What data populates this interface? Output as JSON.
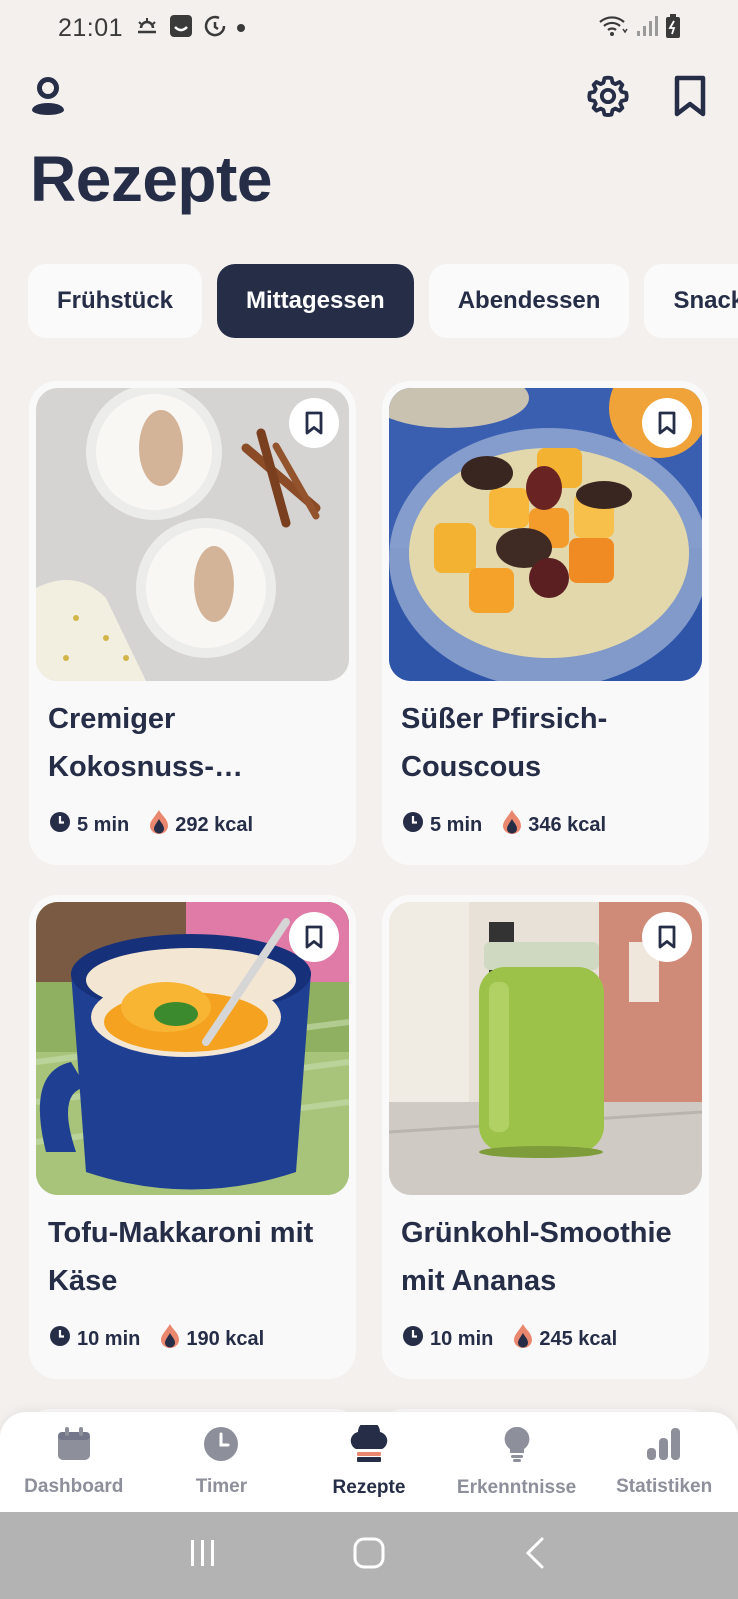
{
  "status_bar": {
    "time": "21:01"
  },
  "header": {
    "title": "Rezepte"
  },
  "tabs": [
    {
      "label": "Frühstück",
      "active": false
    },
    {
      "label": "Mittagessen",
      "active": true
    },
    {
      "label": "Abendessen",
      "active": false
    },
    {
      "label": "Snacks",
      "active": false
    }
  ],
  "recipes": [
    {
      "title": "Cremiger Kokosnuss-Reispu…",
      "time": "5 min",
      "kcal": "292 kcal",
      "image": "rice-pudding"
    },
    {
      "title": "Süßer Pfirsich-Couscous",
      "time": "5 min",
      "kcal": "346 kcal",
      "image": "peach-couscous"
    },
    {
      "title": "Tofu-Makkaroni mit Käse",
      "time": "10 min",
      "kcal": "190 kcal",
      "image": "mac-mug"
    },
    {
      "title": "Grünkohl-Smoothie mit Ananas",
      "time": "10 min",
      "kcal": "245 kcal",
      "image": "green-smoothie"
    }
  ],
  "bottom_nav": [
    {
      "label": "Dashboard",
      "icon": "calendar-icon",
      "active": false
    },
    {
      "label": "Timer",
      "icon": "clock-icon",
      "active": false
    },
    {
      "label": "Rezepte",
      "icon": "chef-hat-icon",
      "active": true
    },
    {
      "label": "Erkenntnisse",
      "icon": "lightbulb-icon",
      "active": false
    },
    {
      "label": "Statistiken",
      "icon": "bar-chart-icon",
      "active": false
    }
  ],
  "colors": {
    "primary": "#252d47",
    "background": "#f3f0ee",
    "card": "#faf9f9",
    "flame": "#e9886f"
  }
}
